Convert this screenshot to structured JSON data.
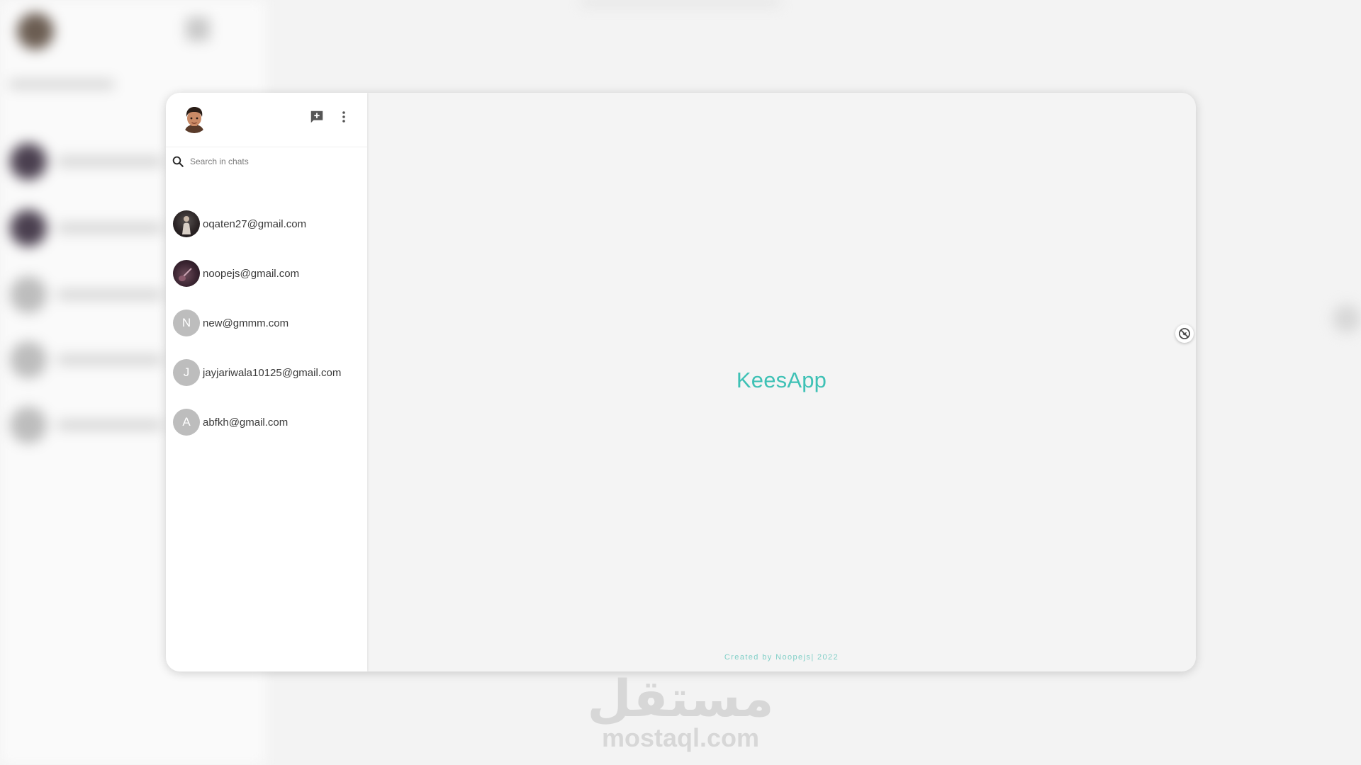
{
  "app": {
    "title": "KeesApp",
    "brand_color": "#3ec1b5"
  },
  "sidebar": {
    "search": {
      "placeholder": "Search in chats",
      "value": ""
    },
    "header_icons": [
      "new-chat-icon",
      "more-vertical-icon"
    ],
    "chats": [
      {
        "label": "oqaten27@gmail.com",
        "avatar": "photo"
      },
      {
        "label": "noopejs@gmail.com",
        "avatar": "photo"
      },
      {
        "label": "new@gmmm.com",
        "avatar": "N"
      },
      {
        "label": "jayjariwala10125@gmail.com",
        "avatar": "J"
      },
      {
        "label": "abfkh@gmail.com",
        "avatar": "A"
      }
    ]
  },
  "footer": {
    "credit": "Created by Noopejs| 2022"
  },
  "watermark": {
    "arabic": "مستقل",
    "domain": "mostaql.com"
  }
}
